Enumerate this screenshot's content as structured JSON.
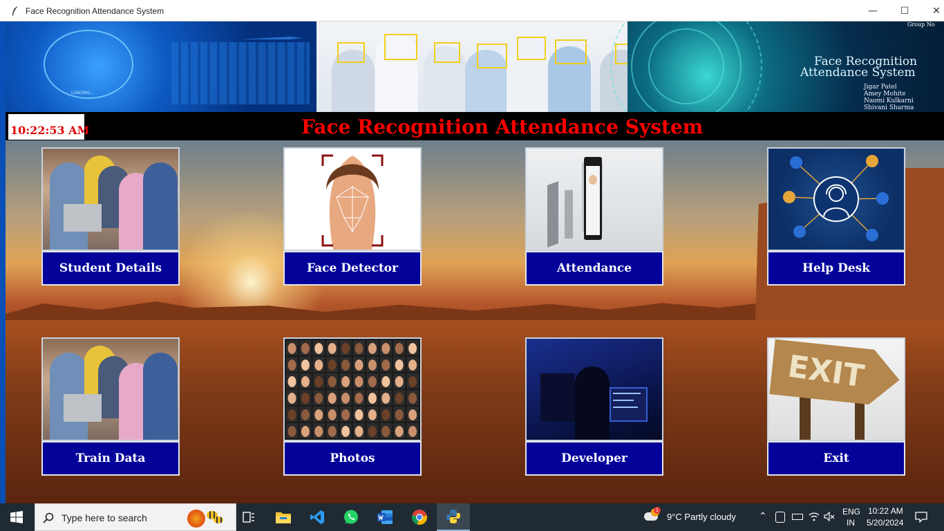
{
  "window": {
    "title": "Face Recognition Attendance System",
    "minimize_glyph": "—",
    "maximize_glyph": "☐",
    "close_glyph": "✕"
  },
  "banner": {
    "left_caption": "LOADING...",
    "right_title_line1": "Face Recognition",
    "right_title_line2": "Attendance System",
    "right_group_label": "Group No",
    "right_names": [
      "Jigar Patel",
      "Amey Mohite",
      "Naomi Kulkarni",
      "Shivani Sharma"
    ]
  },
  "header": {
    "clock": "10:22:53 AM",
    "title": "Face Recognition Attendance System",
    "title_color": "#ff0000"
  },
  "tiles": [
    {
      "id": "student-details",
      "label": "Student Details",
      "icon": "students-photo"
    },
    {
      "id": "face-detector",
      "label": "Face Detector",
      "icon": "face-mesh"
    },
    {
      "id": "attendance",
      "label": "Attendance",
      "icon": "attendance-terminal"
    },
    {
      "id": "help-desk",
      "label": "Help Desk",
      "icon": "headset-support"
    },
    {
      "id": "train-data",
      "label": "Train Data",
      "icon": "students-photo"
    },
    {
      "id": "photos",
      "label": "Photos",
      "icon": "face-grid"
    },
    {
      "id": "developer",
      "label": "Developer",
      "icon": "developer-desk"
    },
    {
      "id": "exit",
      "label": "Exit",
      "icon": "exit-sign"
    }
  ],
  "exit_sign_text": "EXIT",
  "button_color": "#03039a",
  "taskbar": {
    "search_placeholder": "Type here to search",
    "weather": "9°C  Partly cloudy",
    "weather_badge": "1",
    "lang_line1": "ENG",
    "lang_line2": "IN",
    "time": "10:22 AM",
    "date": "5/20/2024"
  }
}
